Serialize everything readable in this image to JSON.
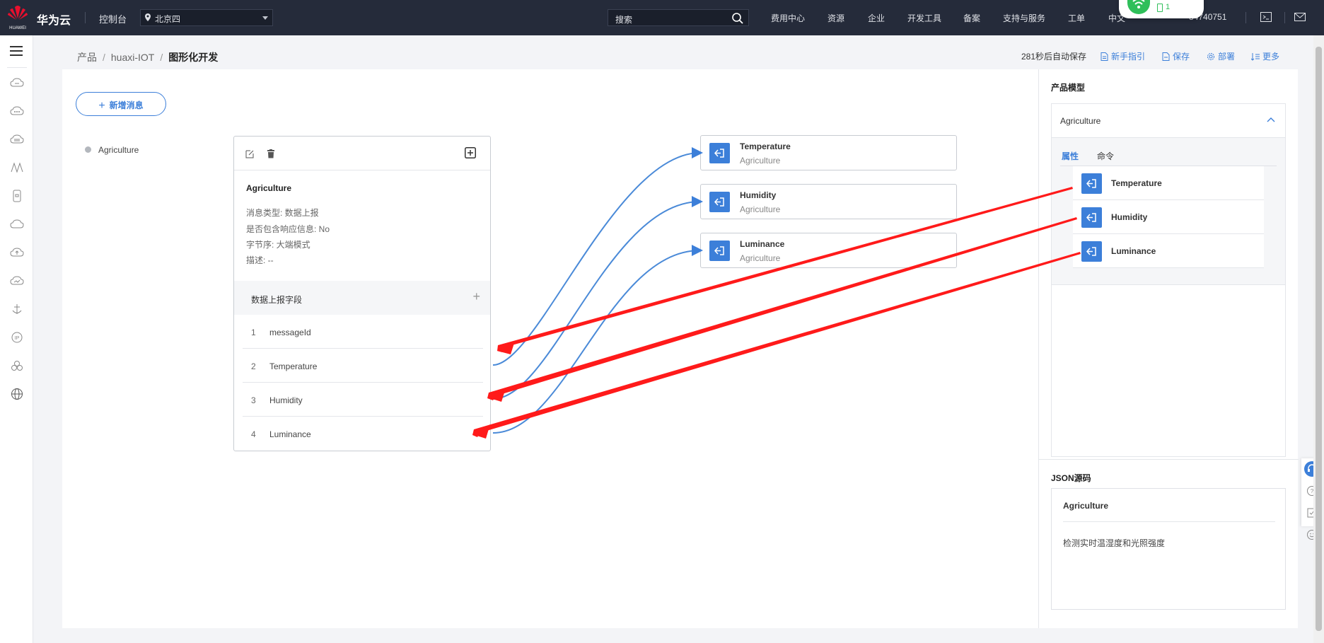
{
  "topbar": {
    "brand": "华为云",
    "brand_logo_text": "HUAWEI",
    "console": "控制台",
    "region": "北京四",
    "search_placeholder": "搜索",
    "nav": [
      "费用中心",
      "资源",
      "企业",
      "开发工具",
      "备案",
      "支持与服务",
      "工单",
      "中文"
    ],
    "account_suffix": "84740751",
    "battery_count": "1"
  },
  "breadcrumb": {
    "items": [
      "产品",
      "huaxi-IOT"
    ],
    "current": "图形化开发"
  },
  "actions": {
    "autosave": "281秒后自动保存",
    "guide": "新手指引",
    "save": "保存",
    "deploy": "部署",
    "more": "更多"
  },
  "canvas": {
    "add_message": "新增消息",
    "message_list": [
      "Agriculture"
    ],
    "message": {
      "title": "Agriculture",
      "props": [
        "消息类型: 数据上报",
        "是否包含响应信息: No",
        "字节序: 大端模式",
        "描述: --"
      ],
      "fields_header": "数据上报字段",
      "fields": [
        {
          "index": "1",
          "name": "messageId"
        },
        {
          "index": "2",
          "name": "Temperature"
        },
        {
          "index": "3",
          "name": "Humidity"
        },
        {
          "index": "4",
          "name": "Luminance"
        }
      ]
    },
    "mapped_props": [
      {
        "name": "Temperature",
        "service": "Agriculture"
      },
      {
        "name": "Humidity",
        "service": "Agriculture"
      },
      {
        "name": "Luminance",
        "service": "Agriculture"
      }
    ]
  },
  "right_panel": {
    "model_title": "产品模型",
    "service_name": "Agriculture",
    "tabs": [
      "属性",
      "命令"
    ],
    "properties": [
      "Temperature",
      "Humidity",
      "Luminance"
    ],
    "json_title": "JSON源码",
    "json_service": "Agriculture",
    "json_desc": "检测实时温湿度和光照强度"
  },
  "colors": {
    "topbar": "#252b3a",
    "accent": "#3c7fd9",
    "annotation_arrow": "#ff1a1a"
  }
}
